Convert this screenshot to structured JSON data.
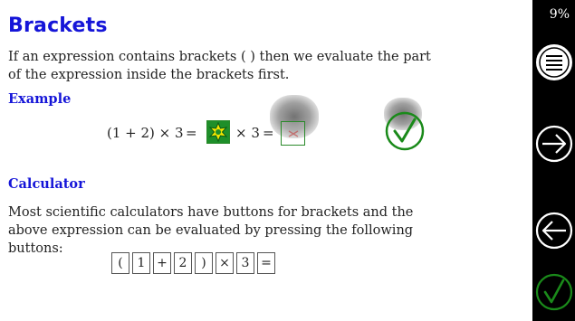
{
  "lesson": {
    "title": "Brackets",
    "intro": "If an expression contains brackets ( ) then we evaluate the part of the expression inside the brackets first."
  },
  "example": {
    "heading": "Example",
    "lhs": "(1 + 2) × 3",
    "equals": "=",
    "times_three": "× 3",
    "equals2": "="
  },
  "calculator": {
    "heading": "Calculator",
    "text": "Most scientific calculators have buttons for brackets and the above expression can be evaluated by pressing the following buttons:",
    "keys": [
      "(",
      "1",
      "+",
      "2",
      ")",
      "×",
      "3",
      "="
    ]
  },
  "sidebar": {
    "progress": "9%",
    "icons": [
      "menu-icon",
      "arrow-right-icon",
      "arrow-left-icon",
      "check-icon"
    ]
  },
  "colors": {
    "heading": "#1515d8",
    "check_green": "#1a8a1a",
    "sidebar_bg": "#000000"
  }
}
